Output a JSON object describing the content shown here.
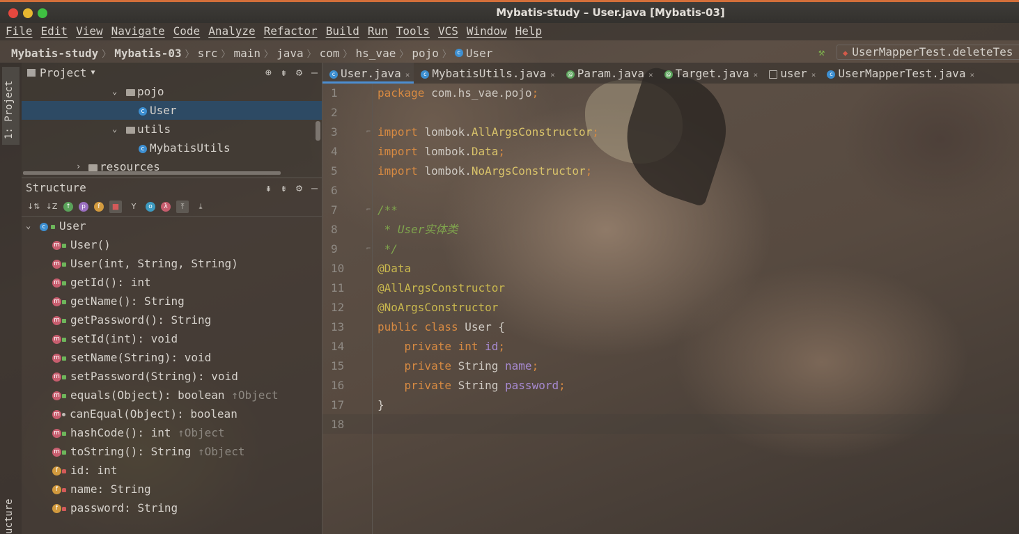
{
  "window": {
    "title": "Mybatis-study – User.java [Mybatis-03]"
  },
  "menu": [
    "File",
    "Edit",
    "View",
    "Navigate",
    "Code",
    "Analyze",
    "Refactor",
    "Build",
    "Run",
    "Tools",
    "VCS",
    "Window",
    "Help"
  ],
  "breadcrumb": [
    "Mybatis-study",
    "Mybatis-03",
    "src",
    "main",
    "java",
    "com",
    "hs_vae",
    "pojo",
    "User"
  ],
  "run_config": "UserMapperTest.deleteTes",
  "side_tabs": {
    "project": "1: Project",
    "structure": "ucture"
  },
  "project_panel": {
    "title": "Project",
    "tree": [
      {
        "label": "pojo",
        "type": "folder",
        "expanded": true
      },
      {
        "label": "User",
        "type": "class",
        "selected": true
      },
      {
        "label": "utils",
        "type": "folder",
        "expanded": true
      },
      {
        "label": "MybatisUtils",
        "type": "class"
      },
      {
        "label": "resources",
        "type": "folder",
        "expanded": false
      }
    ]
  },
  "structure_panel": {
    "title": "Structure",
    "root": "User",
    "members": [
      {
        "label": "User()",
        "kind": "method",
        "vis": "public"
      },
      {
        "label": "User(int, String, String)",
        "kind": "method",
        "vis": "public"
      },
      {
        "label": "getId(): int",
        "kind": "method",
        "vis": "public"
      },
      {
        "label": "getName(): String",
        "kind": "method",
        "vis": "public"
      },
      {
        "label": "getPassword(): String",
        "kind": "method",
        "vis": "public"
      },
      {
        "label": "setId(int): void",
        "kind": "method",
        "vis": "public"
      },
      {
        "label": "setName(String): void",
        "kind": "method",
        "vis": "public"
      },
      {
        "label": "setPassword(String): void",
        "kind": "method",
        "vis": "public"
      },
      {
        "label": "equals(Object): boolean",
        "kind": "method",
        "vis": "public",
        "inherit": "↑Object"
      },
      {
        "label": "canEqual(Object): boolean",
        "kind": "method",
        "vis": "protected"
      },
      {
        "label": "hashCode(): int",
        "kind": "method",
        "vis": "public",
        "inherit": "↑Object"
      },
      {
        "label": "toString(): String",
        "kind": "method",
        "vis": "public",
        "inherit": "↑Object"
      },
      {
        "label": "id: int",
        "kind": "field",
        "vis": "private"
      },
      {
        "label": "name: String",
        "kind": "field",
        "vis": "private"
      },
      {
        "label": "password: String",
        "kind": "field",
        "vis": "private"
      }
    ]
  },
  "tabs": [
    {
      "label": "User.java",
      "icon": "class",
      "active": true
    },
    {
      "label": "MybatisUtils.java",
      "icon": "class"
    },
    {
      "label": "Param.java",
      "icon": "annotation"
    },
    {
      "label": "Target.java",
      "icon": "annotation"
    },
    {
      "label": "user",
      "icon": "table"
    },
    {
      "label": "UserMapperTest.java",
      "icon": "class"
    }
  ],
  "editor": {
    "line_numbers": [
      "1",
      "2",
      "3",
      "4",
      "5",
      "6",
      "7",
      "8",
      "9",
      "10",
      "11",
      "12",
      "13",
      "14",
      "15",
      "16",
      "17",
      "18"
    ],
    "lines": [
      [
        {
          "t": "package ",
          "c": "kw"
        },
        {
          "t": "com.hs_vae.pojo",
          "c": "str"
        },
        {
          "t": ";",
          "c": "kw"
        }
      ],
      [],
      [
        {
          "t": "import ",
          "c": "kw"
        },
        {
          "t": "lombok.",
          "c": "str"
        },
        {
          "t": "AllArgsConstructor",
          "c": "cls"
        },
        {
          "t": ";",
          "c": "kw"
        }
      ],
      [
        {
          "t": "import ",
          "c": "kw"
        },
        {
          "t": "lombok.",
          "c": "str"
        },
        {
          "t": "Data",
          "c": "cls"
        },
        {
          "t": ";",
          "c": "kw"
        }
      ],
      [
        {
          "t": "import ",
          "c": "kw"
        },
        {
          "t": "lombok.",
          "c": "str"
        },
        {
          "t": "NoArgsConstructor",
          "c": "cls"
        },
        {
          "t": ";",
          "c": "kw"
        }
      ],
      [],
      [
        {
          "t": "/**",
          "c": "cmt"
        }
      ],
      [
        {
          "t": " * User实体类",
          "c": "cmt"
        }
      ],
      [
        {
          "t": " */",
          "c": "cmt"
        }
      ],
      [
        {
          "t": "@Data",
          "c": "ann"
        }
      ],
      [
        {
          "t": "@AllArgsConstructor",
          "c": "ann"
        }
      ],
      [
        {
          "t": "@NoArgsConstructor",
          "c": "ann"
        }
      ],
      [
        {
          "t": "public class ",
          "c": "kw"
        },
        {
          "t": "User {",
          "c": "str"
        }
      ],
      [
        {
          "t": "    private int ",
          "c": "kw"
        },
        {
          "t": "id",
          "c": "fld"
        },
        {
          "t": ";",
          "c": "kw"
        }
      ],
      [
        {
          "t": "    private ",
          "c": "kw"
        },
        {
          "t": "String ",
          "c": "str"
        },
        {
          "t": "name",
          "c": "fld"
        },
        {
          "t": ";",
          "c": "kw"
        }
      ],
      [
        {
          "t": "    private ",
          "c": "kw"
        },
        {
          "t": "String ",
          "c": "str"
        },
        {
          "t": "password",
          "c": "fld"
        },
        {
          "t": ";",
          "c": "kw"
        }
      ],
      [
        {
          "t": "}",
          "c": "str"
        }
      ],
      []
    ]
  },
  "colors": {
    "keyword": "#d78a42",
    "annotation": "#c9b84e",
    "comment": "#7fa44d",
    "field": "#a78ad1",
    "selection": "#2d4a64",
    "active_tab_underline": "#4c8ed1"
  }
}
